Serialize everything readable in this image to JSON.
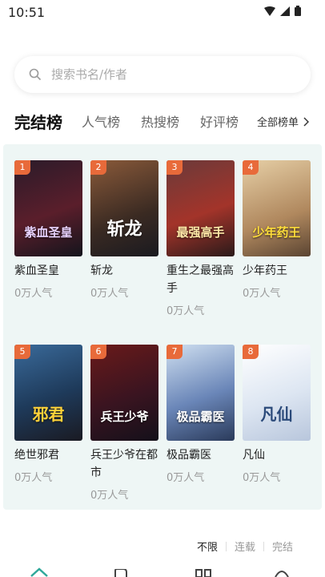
{
  "status": {
    "time": "10:51"
  },
  "search": {
    "placeholder": "搜索书名/作者"
  },
  "tabs": [
    {
      "label": "完结榜"
    },
    {
      "label": "人气榜"
    },
    {
      "label": "热搜榜"
    },
    {
      "label": "好评榜"
    }
  ],
  "all_lists": "全部榜单",
  "books": [
    {
      "rank": "1",
      "title": "紫血圣皇",
      "meta": "0万人气",
      "cover_color": "#2a1d27"
    },
    {
      "rank": "2",
      "title": "斩龙",
      "meta": "0万人气",
      "cover_color": "#4a3426"
    },
    {
      "rank": "3",
      "title": "重生之最强高手",
      "meta": "0万人气",
      "cover_color": "#7a2a2a"
    },
    {
      "rank": "4",
      "title": "少年药王",
      "meta": "0万人气",
      "cover_color": "#c7a47a"
    },
    {
      "rank": "5",
      "title": "绝世邪君",
      "meta": "0万人气",
      "cover_color": "#2b4a6b"
    },
    {
      "rank": "6",
      "title": "兵王少爷在都市",
      "meta": "0万人气",
      "cover_color": "#3a1a1f"
    },
    {
      "rank": "7",
      "title": "极品霸医",
      "meta": "0万人气",
      "cover_color": "#4a6aa0"
    },
    {
      "rank": "8",
      "title": "凡仙",
      "meta": "0万人气",
      "cover_color": "#e8eef5"
    }
  ],
  "cover_text": [
    "紫血圣皇",
    "斩龙",
    "最强高手",
    "少年药王",
    "邪君",
    "兵王少爷",
    "极品霸医",
    "凡仙"
  ],
  "filter": {
    "unlimited": "不限",
    "serial": "连载",
    "completed": "完结"
  }
}
